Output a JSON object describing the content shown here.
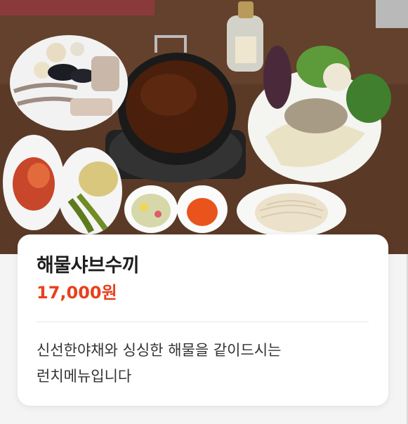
{
  "menu_item": {
    "image_alt": "해물샤브수끼",
    "title": "해물샤브수끼",
    "price": "17,000원",
    "description": "신선한야채와 싱싱한 해물을 같이드시는 런치메뉴입니다"
  },
  "colors": {
    "price": "#e8401c",
    "title": "#1e1e1e",
    "card_background": "#ffffff",
    "page_background": "#f4f4f4"
  }
}
